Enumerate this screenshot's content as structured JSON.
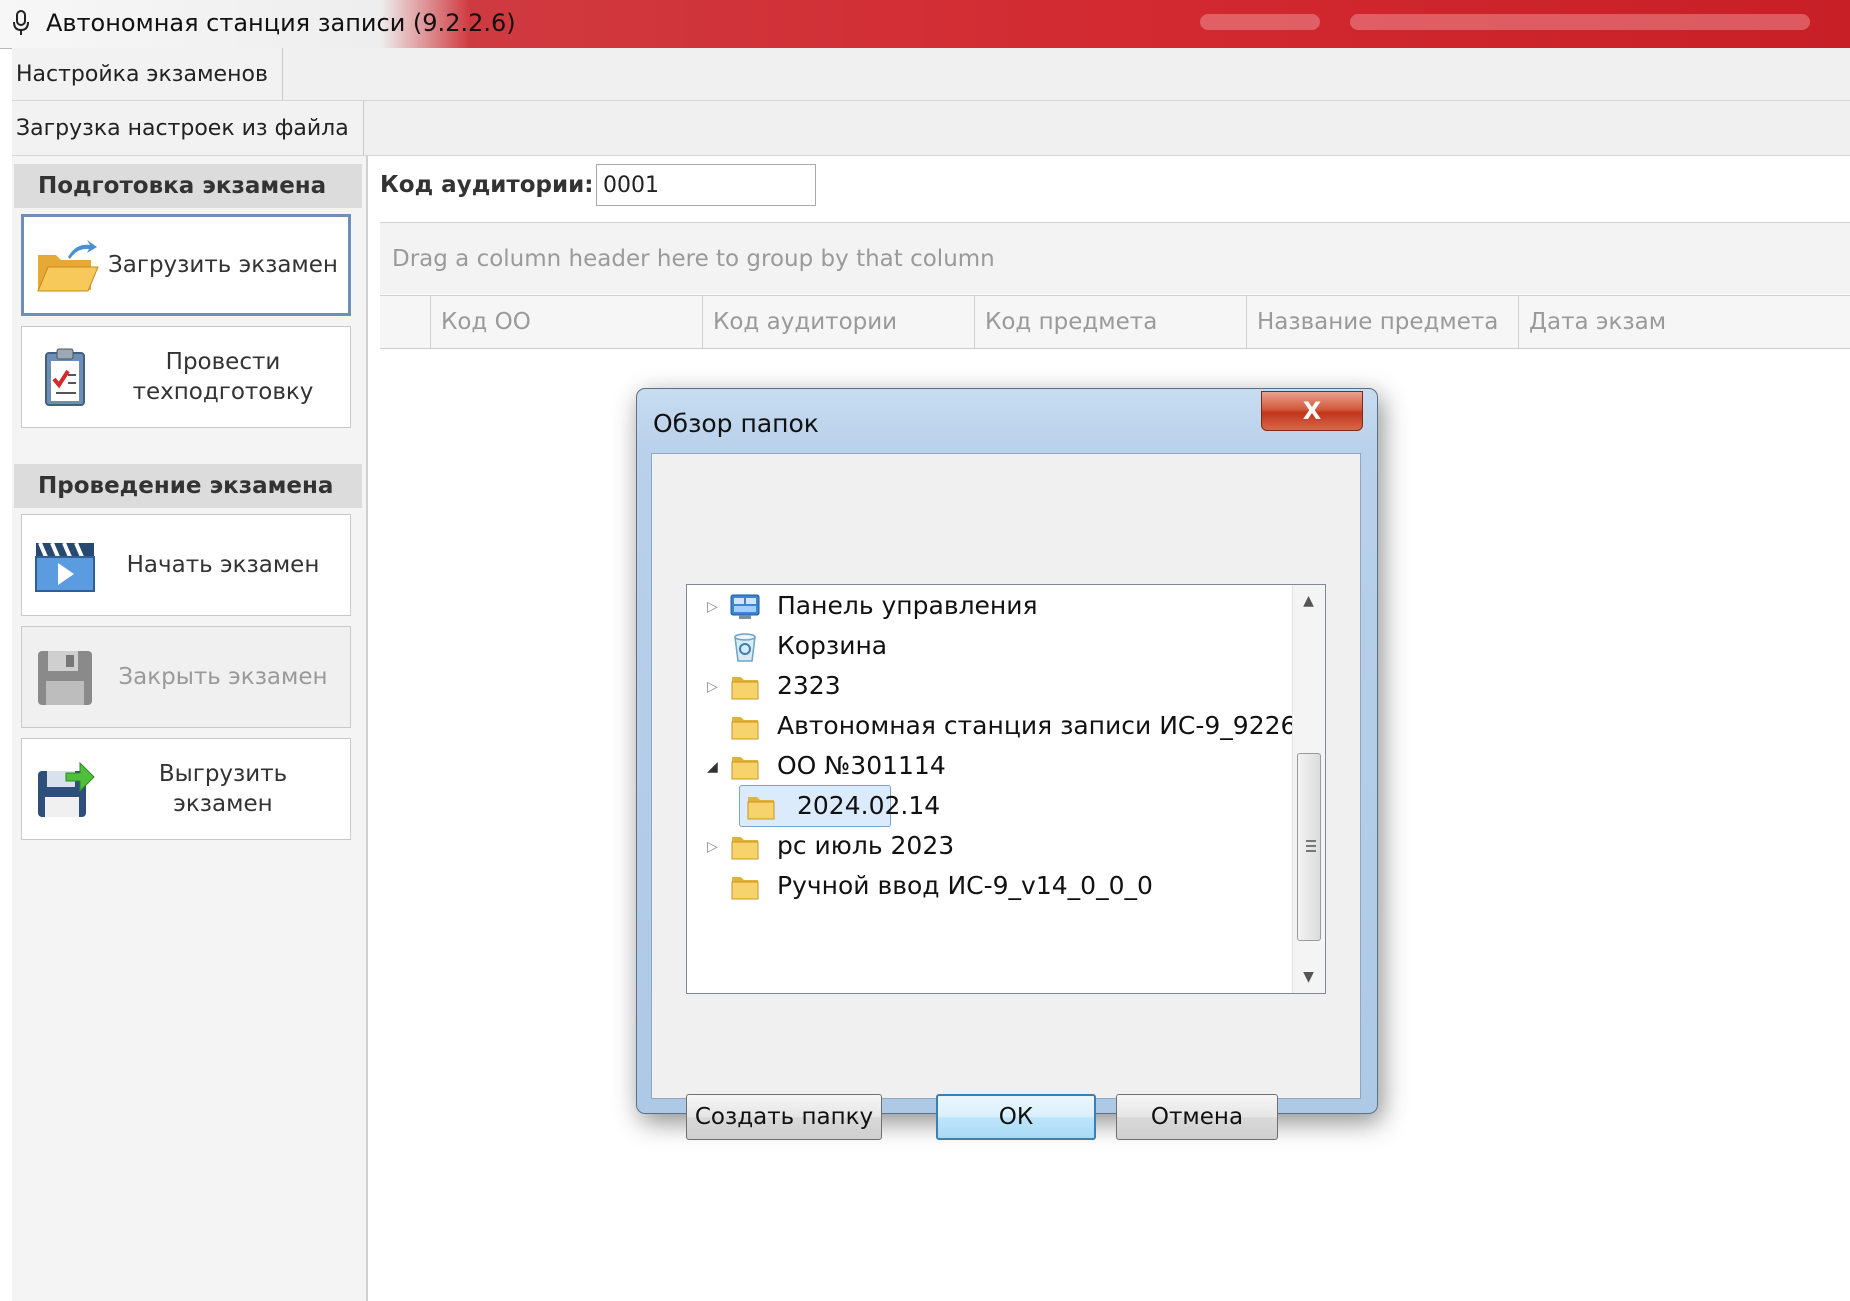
{
  "window": {
    "title": "Автономная станция записи (9.2.2.6)",
    "icon": "microphone-icon"
  },
  "menu": {
    "row1_tab": "Настройка экзаменов",
    "row2_tab": "Загрузка настроек из файла"
  },
  "sidebar": {
    "group1": "Подготовка экзамена",
    "group2": "Проведение экзамена",
    "buttons": [
      {
        "label": "Загрузить экзамен",
        "icon": "open-folder-icon",
        "state": "active"
      },
      {
        "label": "Провести техподготовку",
        "icon": "clipboard-check-icon",
        "state": "normal"
      },
      {
        "label": "Начать экзамен",
        "icon": "play-video-icon",
        "state": "normal"
      },
      {
        "label": "Закрыть экзамен",
        "icon": "floppy-disk-icon",
        "state": "disabled"
      },
      {
        "label": "Выгрузить экзамен",
        "icon": "save-export-icon",
        "state": "normal"
      }
    ]
  },
  "main": {
    "room_code_label": "Код аудитории:",
    "room_code_value": "0001",
    "group_hint": "Drag a column header here to group by that column",
    "columns": [
      "Код ОО",
      "Код аудитории",
      "Код предмета",
      "Название предмета",
      "Дата экзам"
    ]
  },
  "dialog": {
    "title": "Обзор папок",
    "close_label": "X",
    "tree": [
      {
        "label": "Панель управления",
        "icon": "control-panel-icon",
        "expander": "collapsed",
        "indent": 0
      },
      {
        "label": "Корзина",
        "icon": "recycle-bin-icon",
        "expander": "none",
        "indent": 0
      },
      {
        "label": "2323",
        "icon": "folder-icon",
        "expander": "collapsed",
        "indent": 0
      },
      {
        "label": "Автономная станция записи ИС-9_9226",
        "icon": "folder-icon",
        "expander": "none",
        "indent": 0
      },
      {
        "label": "ОО №301114",
        "icon": "folder-icon",
        "expander": "expanded",
        "indent": 0
      },
      {
        "label": "2024.02.14",
        "icon": "folder-icon",
        "expander": "none",
        "indent": 1,
        "selected": true
      },
      {
        "label": "рс июль 2023",
        "icon": "folder-icon",
        "expander": "collapsed",
        "indent": 0
      },
      {
        "label": "Ручной ввод ИС-9_v14_0_0_0",
        "icon": "folder-icon",
        "expander": "none",
        "indent": 0
      }
    ],
    "buttons": {
      "new_folder": "Создать папку",
      "ok": "ОК",
      "cancel": "Отмена"
    }
  },
  "colors": {
    "titlebar_red": "#d32a31",
    "dialog_frame": "#b9d1ea",
    "selection": "#dcebfc",
    "active_border": "#6f8fb8"
  }
}
